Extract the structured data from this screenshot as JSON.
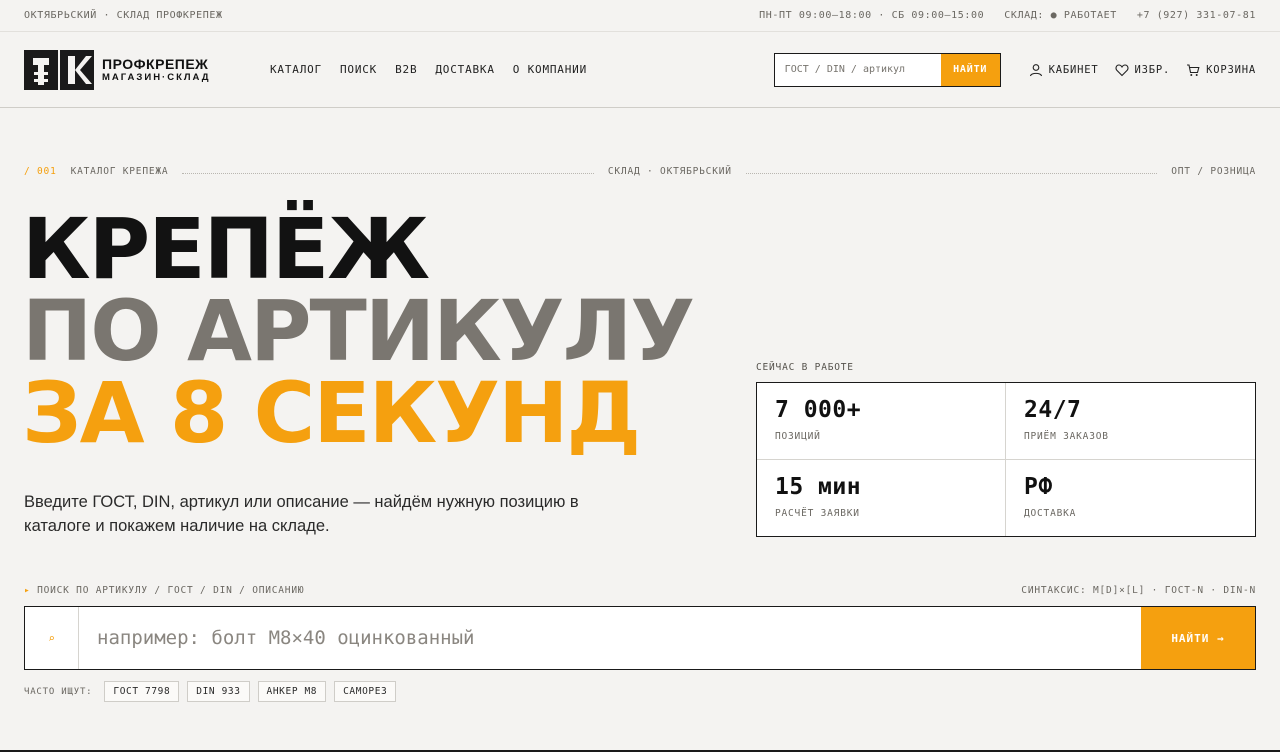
{
  "topbar": {
    "location": "ОКТЯБРЬСКИЙ · СКЛАД ПРОФКРЕПЕЖ",
    "hours": "ПН-ПТ 09:00–18:00 · СБ 09:00–15:00",
    "status": "СКЛАД: ● РАБОТАЕТ",
    "phone": "+7 (927) 331-07-81"
  },
  "brand": {
    "name": "ПРОФКРЕПЕЖ",
    "subtitle": "МАГАЗИН·СКЛАД"
  },
  "nav": [
    "КАТАЛОГ",
    "ПОИСК",
    "B2B",
    "ДОСТАВКА",
    "О КОМПАНИИ"
  ],
  "header_search": {
    "placeholder": "ГОСТ / DIN / артикул",
    "button": "НАЙТИ"
  },
  "actions": {
    "account": "КАБИНЕТ",
    "favorites": "ИЗБР.",
    "cart": "КОРЗИНА"
  },
  "section": {
    "num": "/ 001",
    "title": "КАТАЛОГ КРЕПЕЖА",
    "middle": "СКЛАД · ОКТЯБРЬСКИЙ",
    "right": "ОПТ / РОЗНИЦА"
  },
  "hero": {
    "line1": "КРЕПЁЖ",
    "line2": "ПО АРТИКУЛУ",
    "line3": "ЗА 8 СЕКУНД",
    "description": "Введите ГОСТ, DIN, артикул или описание — найдём нужную позицию в каталоге и покажем наличие на складе."
  },
  "stats": {
    "label": "СЕЙЧАС В РАБОТЕ",
    "items": [
      {
        "value": "7 000+",
        "caption": "ПОЗИЦИЙ"
      },
      {
        "value": "24/7",
        "caption": "ПРИЁМ ЗАКАЗОВ"
      },
      {
        "value": "15 мин",
        "caption": "РАСЧЁТ ЗАЯВКИ"
      },
      {
        "value": "РФ",
        "caption": "ДОСТАВКА"
      }
    ]
  },
  "search": {
    "label_arrow": "▸",
    "label": "ПОИСК ПО АРТИКУЛУ / ГОСТ / DIN / ОПИСАНИЮ",
    "syntax": "СИНТАКСИС: M[D]×[L] · ГОСТ-N · DIN-N",
    "icon_glyph": "⌕",
    "placeholder": "например: болт М8×40 оцинкованный",
    "button": "НАЙТИ →"
  },
  "popular": {
    "label": "ЧАСТО ИЩУТ:",
    "chips": [
      "ГОСТ 7798",
      "DIN 933",
      "АНКЕР М8",
      "САМОРЕЗ"
    ]
  },
  "colors": {
    "accent": "#f5a00f",
    "ink": "#121212",
    "muted": "#7a7670",
    "background": "#f4f3f1"
  }
}
